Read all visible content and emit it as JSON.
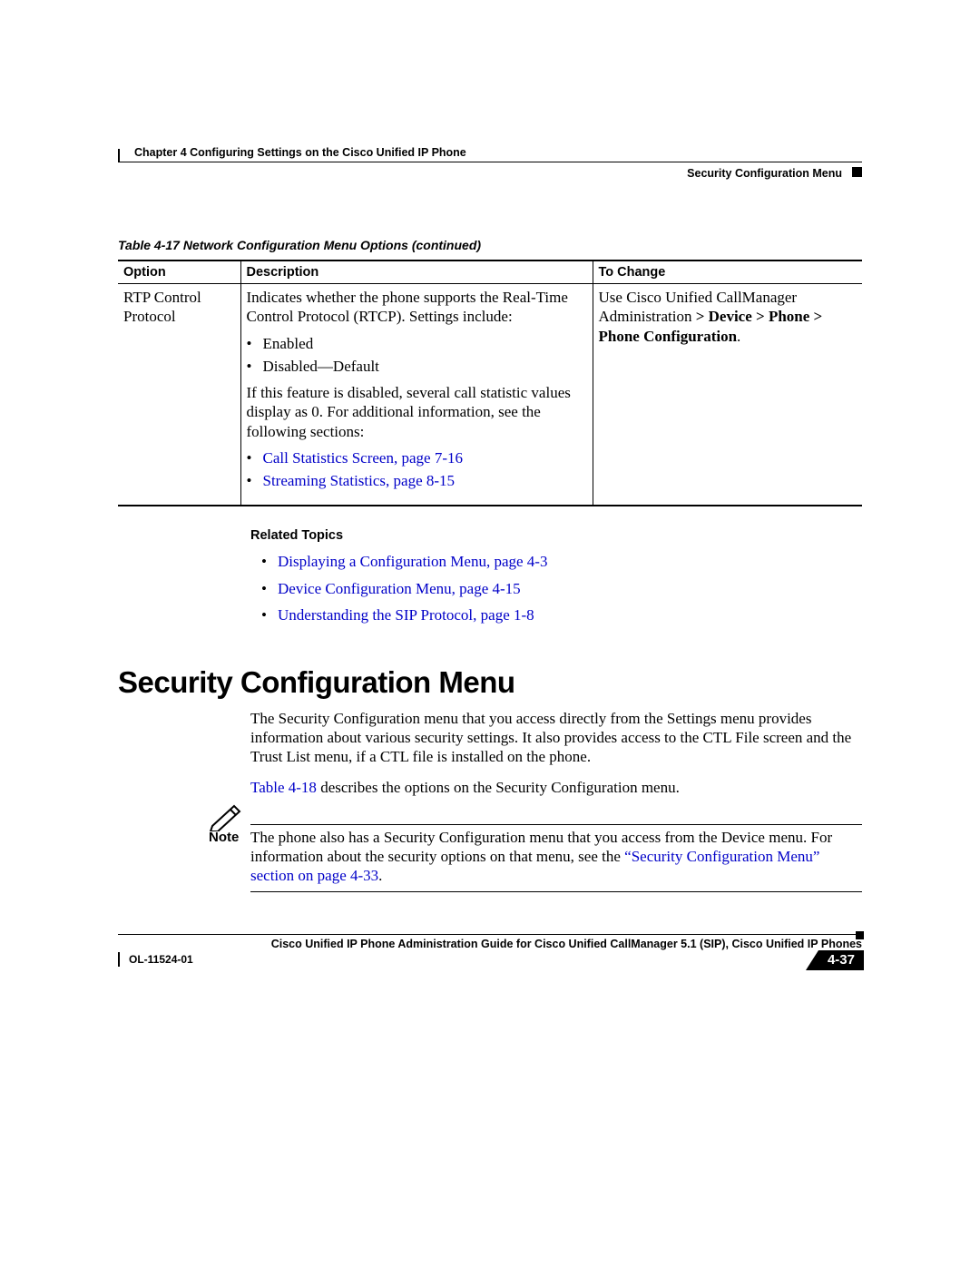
{
  "header": {
    "chapter": "Chapter 4      Configuring Settings on the Cisco Unified IP Phone",
    "section": "Security Configuration Menu"
  },
  "table": {
    "caption": "Table 4-17   Network Configuration Menu Options (continued)",
    "headers": {
      "option": "Option",
      "description": "Description",
      "to_change": "To Change"
    },
    "row": {
      "option": "RTP Control Protocol",
      "desc_p1": "Indicates whether the phone supports the Real-Time Control Protocol (RTCP). Settings include:",
      "bullets1": [
        "Enabled",
        "Disabled—Default"
      ],
      "desc_p2": "If this feature is disabled, several call statistic values display as 0. For additional information, see the following sections:",
      "links": [
        "Call Statistics Screen, page 7-16",
        "Streaming Statistics, page 8-15"
      ],
      "chg_pre": "Use Cisco Unified CallManager Administration ",
      "chg_bold1": "> Device > Phone > Phone Configuration",
      "chg_post": "."
    }
  },
  "related": {
    "heading": "Related Topics",
    "items": [
      "Displaying a Configuration Menu, page 4-3",
      "Device Configuration Menu, page 4-15",
      "Understanding the SIP Protocol, page 1-8"
    ]
  },
  "section": {
    "title": "Security Configuration Menu",
    "p1": "The Security Configuration menu that you access directly from the Settings menu provides information about various security settings. It also provides access to the CTL File screen and the Trust List menu, if a CTL file is installed on the phone.",
    "p2a": "Table 4-18",
    "p2b": " describes the options on the Security Configuration menu."
  },
  "note": {
    "label": "Note",
    "text_a": "The phone also has a Security Configuration menu that you access from the Device menu. For information about the security options on that menu, see the ",
    "link": "“Security Configuration Menu” section on page 4-33",
    "text_b": "."
  },
  "footer": {
    "title": "Cisco Unified IP Phone Administration Guide for Cisco Unified CallManager 5.1 (SIP), Cisco Unified IP Phones",
    "ol": "OL-11524-01",
    "page": "4-37"
  }
}
